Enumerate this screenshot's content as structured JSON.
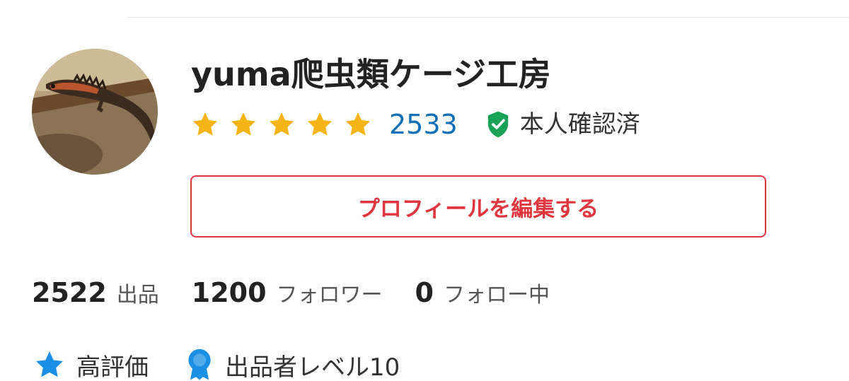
{
  "profile": {
    "shop_name": "yuma爬虫類ケージ工房",
    "rating_stars": 5,
    "review_count": "2533",
    "verified_label": "本人確認済",
    "edit_button_label": "プロフィールを編集する"
  },
  "stats": [
    {
      "number": "2522",
      "label": "出品"
    },
    {
      "number": "1200",
      "label": "フォロワー"
    },
    {
      "number": "0",
      "label": "フォロー中"
    }
  ],
  "badges": [
    {
      "icon": "star-icon",
      "label": "高評価"
    },
    {
      "icon": "ribbon-medal-icon",
      "label": "出品者レベル10"
    }
  ],
  "colors": {
    "star": "#f6b417",
    "link_blue": "#0f6fb8",
    "verified_green": "#1aa158",
    "accent_red": "#e0363f",
    "badge_blue": "#1a8fe3"
  }
}
